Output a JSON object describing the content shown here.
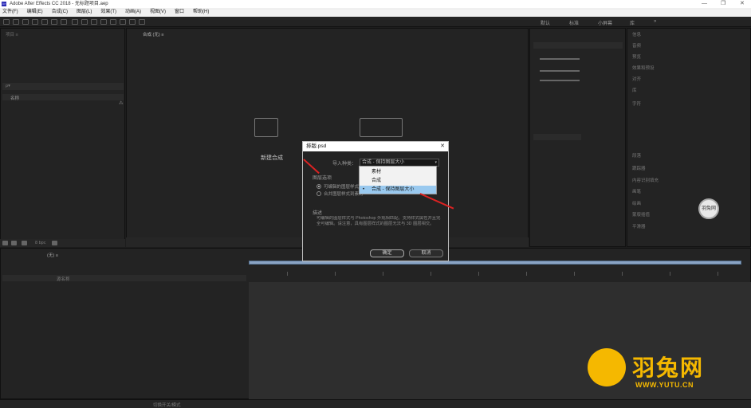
{
  "window": {
    "title": "Adobe After Effects CC 2018 - 无标题项目.aep",
    "app_icon": "Ae",
    "controls": [
      "—",
      "❐",
      "✕"
    ]
  },
  "menu": [
    "文件(F)",
    "编辑(E)",
    "合成(C)",
    "图层(L)",
    "效果(T)",
    "动画(A)",
    "视图(V)",
    "窗口",
    "帮助(H)"
  ],
  "workspaces": [
    "默认",
    "标准",
    "小屏幕",
    "库",
    "»"
  ],
  "project_panel": {
    "tab": "项目 ≡",
    "search_placeholder": "ρ▾",
    "column_name": "名称",
    "bpc": "8 bpc"
  },
  "comp_panel": {
    "tab": "合成 (无) ≡",
    "new_comp_label": "新建合成"
  },
  "timeline": {
    "tab": "(无) ≡",
    "layer_col": "源名称",
    "status": "切换开关/模式"
  },
  "right_panels": [
    "信息",
    "音频",
    "预览",
    "效果和预设",
    "对齐",
    "库",
    "字符",
    "段落",
    "跟踪器",
    "内容识别填充",
    "画笔",
    "绘画",
    "蒙版插值",
    "平滑器",
    "摇摆器"
  ],
  "dialog": {
    "title": "排版.psd",
    "close": "✕",
    "import_kind_label": "导入种类：",
    "import_kind_value": "合成 - 保持图层大小",
    "options": [
      {
        "label": "素材",
        "selected": false
      },
      {
        "label": "合成",
        "selected": false
      },
      {
        "label": "合成 - 保持图层大小",
        "selected": true
      }
    ],
    "layer_options_label": "图层选项",
    "radio1": "可编辑的图层样式",
    "radio2": "合并图层样式到素材",
    "desc_label": "描述",
    "description": "可编辑的图层样式与 Photoshop 外观相匹配。支持样式属性并且完全可编辑。请注意，具有图层样式的图层无法与 3D 图层相交。",
    "ok": "确定",
    "cancel": "取消"
  },
  "watermark": {
    "badge": "羽兔网",
    "brand": "羽兔网",
    "url": "WWW.YUTU.CN"
  },
  "colors": {
    "accent": "#99c9ef",
    "annotation": "#dd2222",
    "brand": "#f5b800"
  }
}
